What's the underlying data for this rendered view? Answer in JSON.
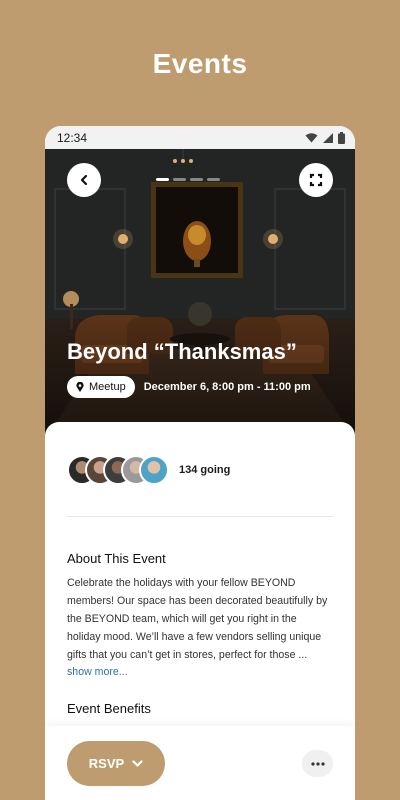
{
  "page": {
    "heading": "Events"
  },
  "status_bar": {
    "time": "12:34",
    "icons": [
      "wifi-icon",
      "signal-icon",
      "battery-icon"
    ]
  },
  "hero": {
    "pager": {
      "count": 4,
      "active_index": 0
    },
    "title": "Beyond “Thanksmas”",
    "tag": {
      "label": "Meetup",
      "icon": "location-pin-icon"
    },
    "datetime": "December 6, 8:00 pm - 11:00 pm"
  },
  "attendees": {
    "count_label": "134 going"
  },
  "about": {
    "title": "About This Event",
    "text": "Celebrate the holidays with your fellow BEYOND members! Our space has been decorated beautifully by the BEYOND team, which will get you right in the holiday mood. We’ll have a few vendors selling unique gifts that you can’t get in stores, perfect for those ...",
    "more_link": "show more..."
  },
  "benefits": {
    "title": "Event Benefits"
  },
  "actions": {
    "rsvp_label": "RSVP"
  },
  "colors": {
    "brand": "#bf9c6f",
    "link": "#2f6fb3",
    "sheet": "#ffffff"
  }
}
